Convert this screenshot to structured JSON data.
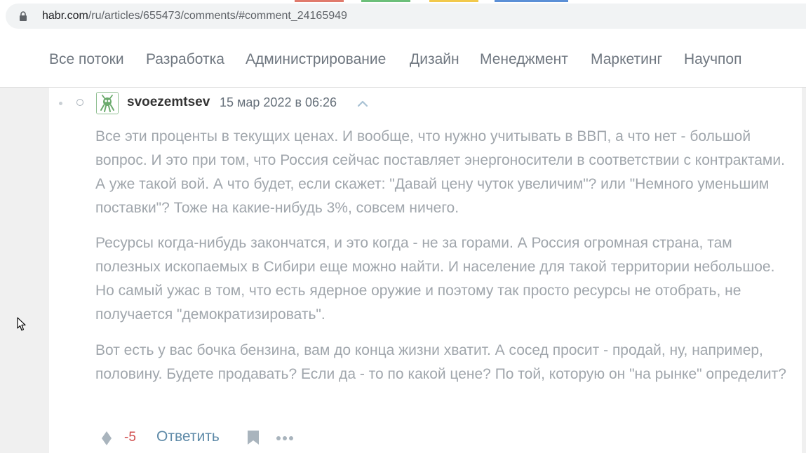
{
  "browser": {
    "url_host": "habr.com",
    "url_path": "/ru/articles/655473/comments/#comment_24165949"
  },
  "nav": {
    "items": [
      {
        "label": "Все потоки"
      },
      {
        "label": "Разработка"
      },
      {
        "label": "Администрирование"
      },
      {
        "label": "Дизайн"
      },
      {
        "label": "Менеджмент"
      },
      {
        "label": "Маркетинг"
      },
      {
        "label": "Научпоп"
      }
    ]
  },
  "comment": {
    "username": "svoezemtsev",
    "timestamp": "15 мар 2022 в 06:26",
    "paragraphs": [
      "Все эти проценты в текущих ценах. И вообще, что нужно учитывать в ВВП, а что нет - большой вопрос. И это при том, что Россия сейчас поставляет энергоносители в соответствии с контрактами. А уже такой вой. А что будет, если скажет: \"Давай цену чуток увеличим\"? или \"Немного уменьшим поставки\"? Тоже на какие-нибудь 3%, совсем ничего.",
      "Ресурсы когда-нибудь закончатся, и это когда - не за горами. А Россия огромная страна, там полезных ископаемых в Сибири еще можно найти. И население для такой территории небольшое. Но самый ужас в том, что есть ядерное оружие и поэтому так просто ресурсы не отобрать, не получается \"демократизировать\".",
      "Вот есть у вас бочка бензина, вам до конца жизни хватит. А сосед просит - продай, ну, например, половину. Будете продавать? Если да - то по какой цене? По той, которую он \"на рынке\" определит?"
    ],
    "score": "-5",
    "reply_label": "Ответить"
  },
  "icons": {
    "lock": "lock-icon",
    "avatar": "robot-avatar-icon",
    "collapse": "chevron-up-icon",
    "vote": "vote-diamond-icon",
    "bookmark": "bookmark-icon",
    "more": "more-dots-icon",
    "cursor": "mouse-pointer-icon"
  },
  "colors": {
    "score_negative": "#d04e4e",
    "link": "#5e8aa8",
    "text_muted": "#a0a6ac",
    "avatar_green": "#6aaa6c"
  }
}
